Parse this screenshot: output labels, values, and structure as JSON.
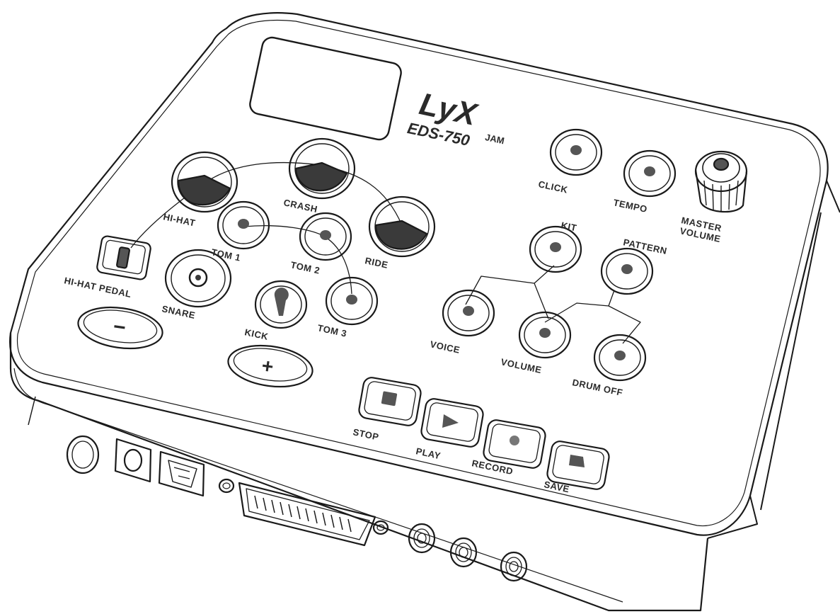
{
  "brand": {
    "logo": "LyX",
    "sub": "JAM",
    "model": "EDS-750"
  },
  "pads": {
    "hihat": "HI-HAT",
    "crash": "CRASH",
    "ride": "RIDE",
    "tom1": "TOM 1",
    "tom2": "TOM 2",
    "tom3": "TOM 3",
    "snare": "SNARE",
    "kick": "KICK",
    "hihat_pedal": "HI-HAT PEDAL"
  },
  "controls": {
    "click": "CLICK",
    "tempo": "TEMPO",
    "master_volume_1": "MASTER",
    "master_volume_2": "VOLUME",
    "kit": "KIT",
    "pattern": "PATTERN",
    "voice": "VOICE",
    "volume": "VOLUME",
    "drum_off": "DRUM OFF",
    "minus": "−",
    "plus": "+"
  },
  "transport": {
    "stop": "STOP",
    "play": "PLAY",
    "record": "RECORD",
    "save": "SAVE"
  },
  "colors": {
    "outline": "#1a1a1a",
    "body": "#ffffff",
    "indicator": "#555555"
  }
}
